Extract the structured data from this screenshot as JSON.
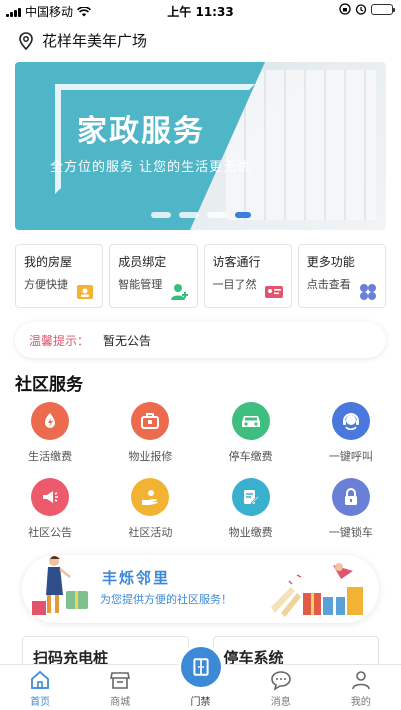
{
  "status_bar": {
    "carrier": "中国移动",
    "time": "上午 11:33"
  },
  "location": {
    "name": "花样年美年广场",
    "icon": "location-pin-icon"
  },
  "banner": {
    "title": "家政服务",
    "subtitle": "全方位的服务  让您的生活更无忧",
    "slide_count": 4,
    "active_slide": 4
  },
  "quick_cards": [
    {
      "title": "我的房屋",
      "subtitle": "方便快捷",
      "icon": "house-card-icon",
      "color": "#f2b233"
    },
    {
      "title": "成员绑定",
      "subtitle": "智能管理",
      "icon": "add-user-icon",
      "color": "#33c07a"
    },
    {
      "title": "访客通行",
      "subtitle": "一目了然",
      "icon": "id-card-icon",
      "color": "#e2536c"
    },
    {
      "title": "更多功能",
      "subtitle": "点击查看",
      "icon": "grid-more-icon",
      "color": "#6a7fd6"
    }
  ],
  "notice": {
    "tag": "温馨提示：",
    "message": "暂无公告"
  },
  "section": {
    "title": "社区服务"
  },
  "services": [
    {
      "label": "生活缴费",
      "icon": "lightning-icon",
      "color": "#ec6a4e"
    },
    {
      "label": "物业报修",
      "icon": "toolbox-icon",
      "color": "#ec6a4e"
    },
    {
      "label": "停车缴费",
      "icon": "car-icon",
      "color": "#3fbf7f"
    },
    {
      "label": "一键呼叫",
      "icon": "headset-icon",
      "color": "#4a78dc"
    },
    {
      "label": "社区公告",
      "icon": "megaphone-icon",
      "color": "#ec5a6c"
    },
    {
      "label": "社区活动",
      "icon": "activity-hand-icon",
      "color": "#f2b233"
    },
    {
      "label": "物业缴费",
      "icon": "bill-edit-icon",
      "color": "#3ab0cf"
    },
    {
      "label": "一键锁车",
      "icon": "lock-icon",
      "color": "#6a7fd6"
    }
  ],
  "promo": {
    "title": "丰烁邻里",
    "subtitle": "为您提供方便的社区服务！"
  },
  "bottom_cards": [
    {
      "title": "扫码充电桩"
    },
    {
      "title": "停车系统"
    }
  ],
  "tabbar": {
    "active": "首页",
    "items": [
      {
        "label": "首页",
        "icon": "home-icon"
      },
      {
        "label": "商城",
        "icon": "shop-icon"
      },
      {
        "label": "门禁",
        "icon": "door-icon"
      },
      {
        "label": "消息",
        "icon": "chat-icon"
      },
      {
        "label": "我的",
        "icon": "person-icon"
      }
    ]
  },
  "colors": {
    "accent": "#3c8ad7",
    "banner_teal": "#4fb6c8",
    "notice_tag": "#e2536c"
  }
}
